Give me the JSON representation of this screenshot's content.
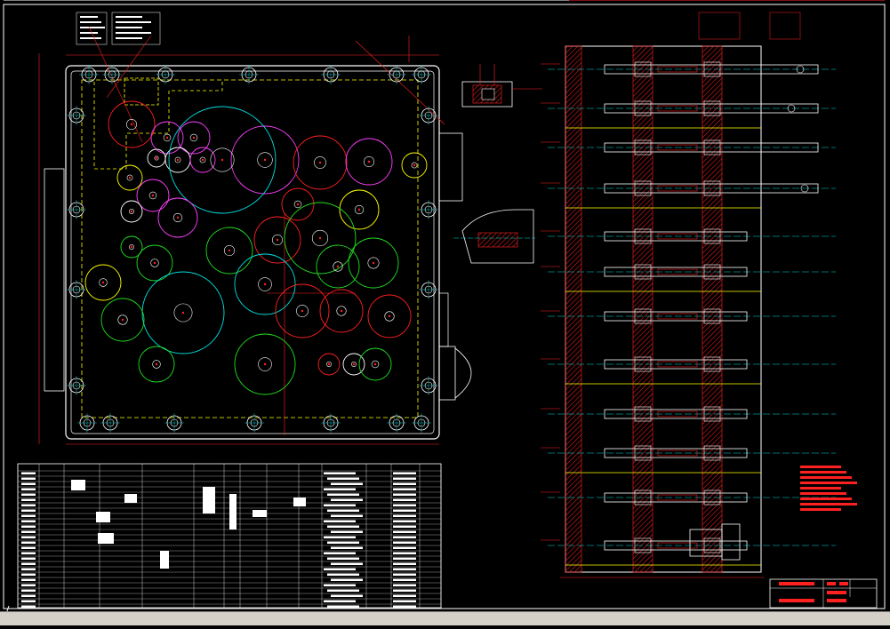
{
  "drawing": {
    "status_text": "",
    "colors": {
      "background": "#000000",
      "frame": "#ffffff",
      "dimension": "#ff2020",
      "centerline": "#00e0e0",
      "housing": "#ffff00",
      "gear_magenta": "#ff40ff",
      "gear_green": "#20e020",
      "gear_red": "#ff2020",
      "gear_yellow": "#ffff00",
      "hatch": "#ff2020"
    }
  }
}
